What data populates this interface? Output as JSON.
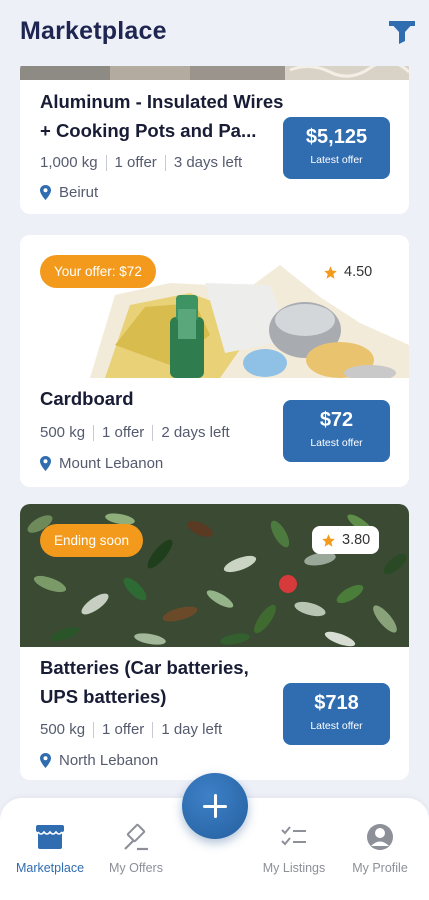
{
  "header": {
    "title": "Marketplace",
    "filter_icon": "filter-icon"
  },
  "listings": [
    {
      "name": "Aluminum - Insulated Wires + Cooking Pots and Pa...",
      "quantity": "1,000 kg",
      "offers": "1 offer",
      "time_left": "3 days left",
      "location": "Beirut",
      "price": "$5,125",
      "price_label": "Latest offer"
    },
    {
      "badge": "Your offer: $72",
      "rating": "4.50",
      "name": "Cardboard",
      "quantity": "500 kg",
      "offers": "1 offer",
      "time_left": "2 days left",
      "location": "Mount Lebanon",
      "price": "$72",
      "price_label": "Latest offer"
    },
    {
      "badge": "Ending soon",
      "rating": "3.80",
      "name": "Batteries (Car batteries, UPS batteries)",
      "quantity": "500 kg",
      "offers": "1 offer",
      "time_left": "1 day left",
      "location": "North Lebanon",
      "price": "$718",
      "price_label": "Latest offer"
    }
  ],
  "bottom_nav": {
    "items": [
      {
        "label": "Marketplace",
        "icon": "store-icon",
        "active": true
      },
      {
        "label": "My Offers",
        "icon": "gavel-icon",
        "active": false
      },
      {
        "label": "My Listings",
        "icon": "checklist-icon",
        "active": false
      },
      {
        "label": "My Profile",
        "icon": "profile-icon",
        "active": false
      }
    ],
    "fab_icon": "plus-icon"
  },
  "colors": {
    "accent": "#2f6cb0",
    "badge": "#f39a1d",
    "star": "#f39a1d",
    "background": "#eef0f8"
  }
}
